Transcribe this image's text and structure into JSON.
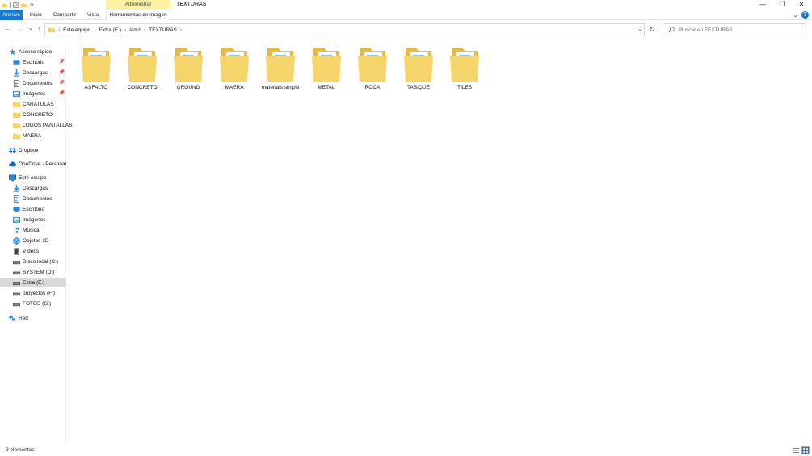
{
  "titlebar": {
    "context_tab": "Administrar",
    "window_title": "TEXTURAS",
    "minimize": "—",
    "maximize": "❐",
    "close": "✕"
  },
  "ribbon": {
    "tabs": [
      {
        "label": "Archivo"
      },
      {
        "label": "Inicio"
      },
      {
        "label": "Compartir"
      },
      {
        "label": "Vista"
      },
      {
        "label": "Herramientas de imagen"
      }
    ],
    "collapse": "⌄",
    "help": "?"
  },
  "nav": {
    "back": "←",
    "forward": "→",
    "recent": "⌄",
    "up": "↑",
    "refresh": "↻",
    "dropdown": "⌄"
  },
  "address": {
    "crumbs": [
      "Este equipo",
      "Extra (E:)",
      "lamz",
      "TEXTURAS"
    ],
    "chevron": "›"
  },
  "search": {
    "placeholder": "Buscar en TEXTURAS"
  },
  "sidebar": {
    "items": [
      {
        "label": "Acceso rápido",
        "icon": "star-icon"
      },
      {
        "label": "Escritorio",
        "icon": "desktop-icon",
        "pinned": true
      },
      {
        "label": "Descargas",
        "icon": "download-icon",
        "pinned": true
      },
      {
        "label": "Documentos",
        "icon": "documents-icon",
        "pinned": true
      },
      {
        "label": "Imágenes",
        "icon": "pictures-icon",
        "pinned": true
      },
      {
        "label": "CARATULAS",
        "icon": "folder-icon"
      },
      {
        "label": "CONCRETO",
        "icon": "folder-icon"
      },
      {
        "label": "LOGOS PANTALLAS",
        "icon": "folder-icon"
      },
      {
        "label": "MAERA",
        "icon": "folder-icon"
      },
      {
        "label": "Dropbox",
        "icon": "dropbox-icon"
      },
      {
        "label": "OneDrive - Personal",
        "icon": "cloud-icon"
      },
      {
        "label": "Este equipo",
        "icon": "computer-icon"
      },
      {
        "label": "Descargas",
        "icon": "download-icon"
      },
      {
        "label": "Documentos",
        "icon": "documents-icon"
      },
      {
        "label": "Escritorio",
        "icon": "desktop-icon"
      },
      {
        "label": "Imágenes",
        "icon": "pictures-icon"
      },
      {
        "label": "Música",
        "icon": "music-icon"
      },
      {
        "label": "Objetos 3D",
        "icon": "cube-icon"
      },
      {
        "label": "Vídeos",
        "icon": "video-icon"
      },
      {
        "label": "Disco local (C:)",
        "icon": "drive-icon"
      },
      {
        "label": "SYSTEM (D:)",
        "icon": "drive-icon"
      },
      {
        "label": "Extra (E:)",
        "icon": "drive-icon",
        "selected": true
      },
      {
        "label": "proyectos (F:)",
        "icon": "drive-icon"
      },
      {
        "label": "FOTOS (G:)",
        "icon": "drive-icon"
      },
      {
        "label": "Red",
        "icon": "network-icon"
      }
    ]
  },
  "folders": [
    {
      "label": "ASFALTO"
    },
    {
      "label": "CONCRETO"
    },
    {
      "label": "GROUND"
    },
    {
      "label": "MAERA"
    },
    {
      "label": "materials simple"
    },
    {
      "label": "METAL"
    },
    {
      "label": "ROCA"
    },
    {
      "label": "TABIQUE"
    },
    {
      "label": "TILES"
    }
  ],
  "status": {
    "count": "9 elementos"
  },
  "colors": {
    "accent": "#1979ca",
    "context_tab": "#fcf1a4",
    "folder": "#f5d46b",
    "folder_dark": "#e8b93f",
    "selected": "#d9d9d9"
  }
}
